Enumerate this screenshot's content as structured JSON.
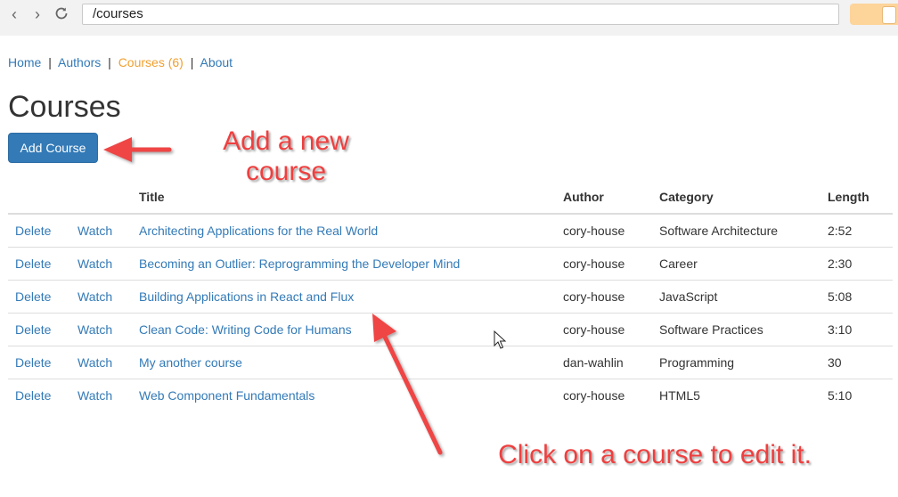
{
  "browser": {
    "back_icon": "chevron-left",
    "forward_icon": "chevron-right",
    "reload_icon": "reload",
    "url": "/courses"
  },
  "app_nav": {
    "home": "Home",
    "authors": "Authors",
    "courses": "Courses (6)",
    "about": "About",
    "separator": "|"
  },
  "page_title": "Courses",
  "add_button_label": "Add Course",
  "table": {
    "headers": {
      "title": "Title",
      "author": "Author",
      "category": "Category",
      "length": "Length"
    },
    "rows": [
      {
        "delete": "Delete",
        "watch": "Watch",
        "title": "Architecting Applications for the Real World",
        "author": "cory-house",
        "category": "Software Architecture",
        "length": "2:52"
      },
      {
        "delete": "Delete",
        "watch": "Watch",
        "title": "Becoming an Outlier: Reprogramming the Developer Mind",
        "author": "cory-house",
        "category": "Career",
        "length": "2:30"
      },
      {
        "delete": "Delete",
        "watch": "Watch",
        "title": "Building Applications in React and Flux",
        "author": "cory-house",
        "category": "JavaScript",
        "length": "5:08"
      },
      {
        "delete": "Delete",
        "watch": "Watch",
        "title": "Clean Code: Writing Code for Humans",
        "author": "cory-house",
        "category": "Software Practices",
        "length": "3:10"
      },
      {
        "delete": "Delete",
        "watch": "Watch",
        "title": "My another course",
        "author": "dan-wahlin",
        "category": "Programming",
        "length": "30"
      },
      {
        "delete": "Delete",
        "watch": "Watch",
        "title": "Web Component Fundamentals",
        "author": "cory-house",
        "category": "HTML5",
        "length": "5:10"
      }
    ]
  },
  "annotations": {
    "add_line1": "Add a new",
    "add_line2": "course",
    "click": "Click on a course to edit it."
  },
  "colors": {
    "link": "#337ab7",
    "active_nav": "#f0a030",
    "primary_button": "#337ab7",
    "annotation": "#ef3f3f"
  }
}
